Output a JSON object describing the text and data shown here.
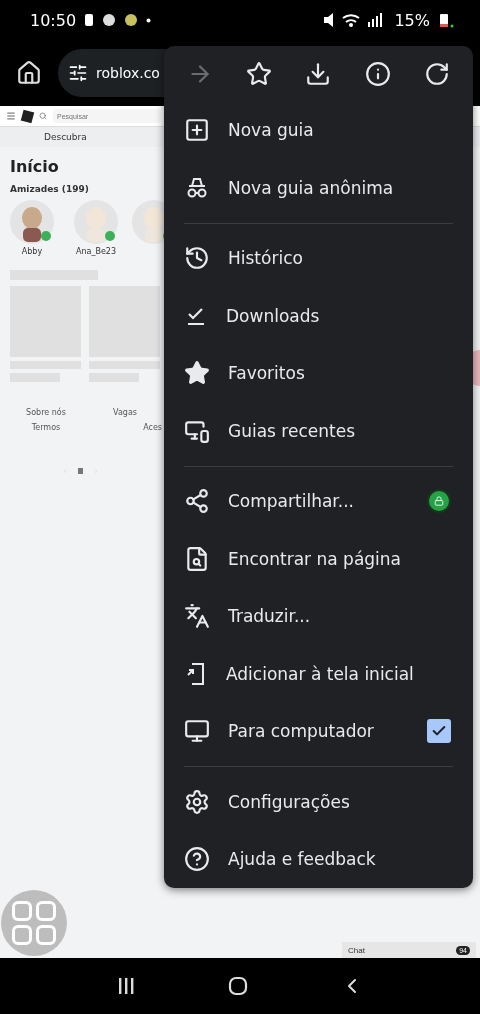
{
  "status_bar": {
    "time": "10:50",
    "battery": "15%"
  },
  "toolbar": {
    "url": "roblox.co"
  },
  "page": {
    "search": {
      "placeholder": "Pesquisar"
    },
    "tab": "Descubra",
    "title": "Início",
    "friends_heading": "Amizades (199)",
    "friends": [
      {
        "name": "Abby"
      },
      {
        "name": "Ana_Be23"
      }
    ],
    "footer_links": [
      "Sobre nós",
      "Vagas",
      "Termos",
      "Aces"
    ],
    "chat": {
      "label": "Chat",
      "count": "94"
    }
  },
  "menu": {
    "top_actions": [
      {
        "kind": "forward",
        "disabled": true
      },
      {
        "kind": "bookmark",
        "disabled": false
      },
      {
        "kind": "download",
        "disabled": false
      },
      {
        "kind": "info",
        "disabled": false
      },
      {
        "kind": "reload",
        "disabled": false
      }
    ],
    "groups": [
      [
        {
          "label": "Nova guia",
          "kind": "plain"
        },
        {
          "label": "Nova guia anônima",
          "kind": "plain"
        }
      ],
      [
        {
          "label": "Histórico",
          "kind": "plain"
        },
        {
          "label": "Downloads",
          "kind": "plain"
        },
        {
          "label": "Favoritos",
          "kind": "plain"
        },
        {
          "label": "Guias recentes",
          "kind": "plain"
        }
      ],
      [
        {
          "label": "Compartilhar...",
          "kind": "share"
        },
        {
          "label": "Encontrar na página",
          "kind": "plain"
        },
        {
          "label": "Traduzir...",
          "kind": "plain"
        },
        {
          "label": "Adicionar à tela inicial",
          "kind": "plain"
        },
        {
          "label": "Para computador",
          "kind": "checkbox",
          "checked": true
        }
      ],
      [
        {
          "label": "Configurações",
          "kind": "plain"
        },
        {
          "label": "Ajuda e feedback",
          "kind": "plain"
        }
      ]
    ]
  }
}
